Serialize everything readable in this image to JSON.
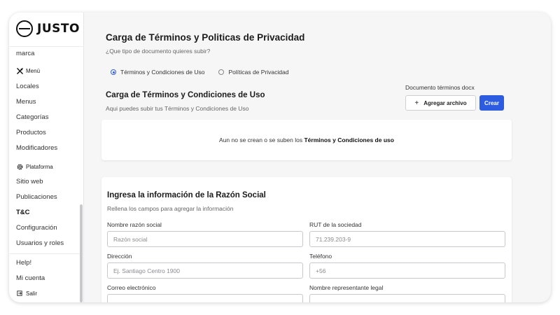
{
  "app": {
    "logo_text": "JUSTO"
  },
  "sidebar": {
    "top_item": "marca",
    "menu_section": "Menú",
    "menu_items": [
      "Locales",
      "Menus",
      "Categorías",
      "Productos",
      "Modificadores"
    ],
    "platform_section": "Plataforma",
    "platform_items": [
      "Sitio web",
      "Publicaciones",
      "T&C",
      "Configuración",
      "Usuarios y roles"
    ],
    "active_item": "T&C",
    "footer_items": [
      "Help!",
      "Mi cuenta"
    ],
    "logout": "Salir"
  },
  "page": {
    "title": "Carga de Términos y Politicas de Privacidad",
    "subtitle": "¿Que tipo de documento quieres subir?",
    "radio_options": [
      "Términos y Condiciones de Uso",
      "Políticas de Privacidad"
    ],
    "radio_selected": "Términos y Condiciones de Uso"
  },
  "upload": {
    "title": "Carga de Términos y Condiciones de Uso",
    "subtitle": "Aqui puedes subir tus Términos y Condiciones de Uso",
    "doc_label": "Documento términos docx",
    "add_file_label": "Agregar archivo",
    "create_label": "Crear",
    "empty_prefix": "Aun no se crean o se suben los ",
    "empty_bold": "Términos y Condiciones de uso",
    "accent_color": "#2d5ce0"
  },
  "form": {
    "title": "Ingresa la información de la Razón Social",
    "subtitle": "Rellena los campos para agregar la información",
    "fields": [
      {
        "label": "Nombre razón social",
        "placeholder": "Razón social"
      },
      {
        "label": "RUT de la sociedad",
        "placeholder": "71.239.203-9"
      },
      {
        "label": "Dirección",
        "placeholder": "Ej. Santiago Centro 1900"
      },
      {
        "label": "Teléfono",
        "placeholder": "+56"
      },
      {
        "label": "Correo electrónico",
        "placeholder": ""
      },
      {
        "label": "Nombre representante legal",
        "placeholder": ""
      }
    ]
  }
}
